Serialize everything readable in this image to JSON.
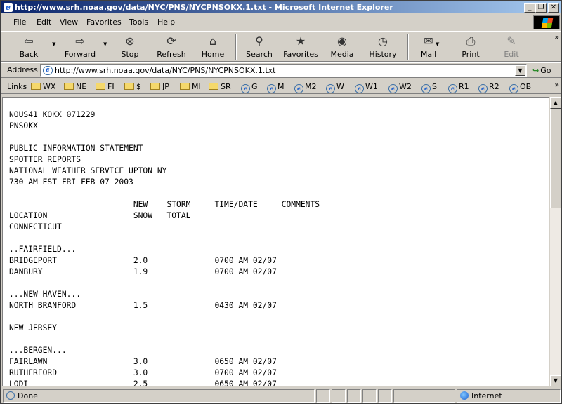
{
  "window": {
    "title": "http://www.srh.noaa.gov/data/NYC/PNS/NYCPNSOKX.1.txt - Microsoft Internet Explorer",
    "minimize": "_",
    "maximize": "❐",
    "close": "✕"
  },
  "menu": [
    "File",
    "Edit",
    "View",
    "Favorites",
    "Tools",
    "Help"
  ],
  "toolbar": {
    "back": "Back",
    "forward": "Forward",
    "stop": "Stop",
    "refresh": "Refresh",
    "home": "Home",
    "search": "Search",
    "favorites": "Favorites",
    "media": "Media",
    "history": "History",
    "mail": "Mail",
    "print": "Print",
    "edit": "Edit"
  },
  "address": {
    "label": "Address",
    "url": "http://www.srh.noaa.gov/data/NYC/PNS/NYCPNSOKX.1.txt",
    "go": "Go"
  },
  "links": {
    "label": "Links",
    "items": [
      "WX",
      "NE",
      "FI",
      "$",
      "JP",
      "MI",
      "SR",
      "G",
      "M",
      "M2",
      "W",
      "W1",
      "W2",
      "S",
      "R1",
      "R2",
      "OB"
    ]
  },
  "document": {
    "lines": [
      "NOUS41 KOKX 071229",
      "PNSOKX",
      "",
      "PUBLIC INFORMATION STATEMENT",
      "SPOTTER REPORTS",
      "NATIONAL WEATHER SERVICE UPTON NY",
      "730 AM EST FRI FEB 07 2003",
      "",
      "                          NEW    STORM     TIME/DATE     COMMENTS",
      "LOCATION                  SNOW   TOTAL",
      "CONNECTICUT",
      "",
      "..FAIRFIELD...",
      "BRIDGEPORT                2.0              0700 AM 02/07",
      "DANBURY                   1.9              0700 AM 02/07",
      "",
      "...NEW HAVEN...",
      "NORTH BRANFORD            1.5              0430 AM 02/07",
      "",
      "NEW JERSEY",
      "",
      "...BERGEN...",
      "FAIRLAWN                  3.0              0650 AM 02/07",
      "RUTHERFORD                3.0              0700 AM 02/07",
      "LODI                      2.5              0650 AM 02/07"
    ]
  },
  "status": {
    "text": "Done",
    "zone": "Internet"
  }
}
